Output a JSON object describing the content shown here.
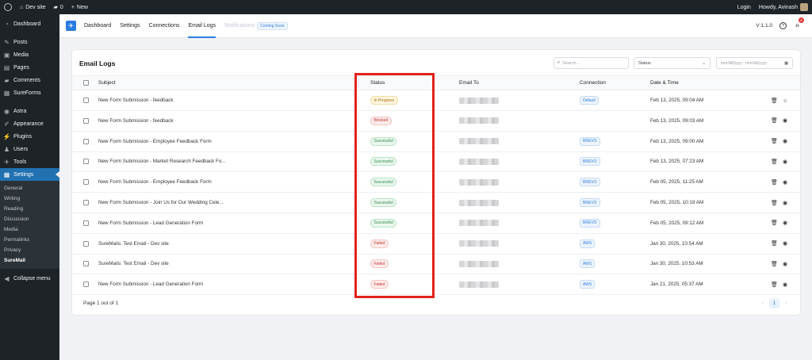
{
  "admin_bar": {
    "site_name": "Dev site",
    "comments_count": "0",
    "new_label": "New",
    "login_label": "Login",
    "howdy": "Howdy, Avinash"
  },
  "sidebar": {
    "items": [
      {
        "label": "Dashboard",
        "icon": "gauge-icon"
      },
      {
        "label": "Posts",
        "icon": "pin-icon"
      },
      {
        "label": "Media",
        "icon": "media-icon"
      },
      {
        "label": "Pages",
        "icon": "pages-icon"
      },
      {
        "label": "Comments",
        "icon": "comment-icon"
      },
      {
        "label": "SureForms",
        "icon": "sureforms-icon"
      },
      {
        "label": "Astra",
        "icon": "astra-icon"
      },
      {
        "label": "Appearance",
        "icon": "brush-icon"
      },
      {
        "label": "Plugins",
        "icon": "plug-icon"
      },
      {
        "label": "Users",
        "icon": "users-icon"
      },
      {
        "label": "Tools",
        "icon": "wrench-icon"
      },
      {
        "label": "Settings",
        "icon": "settings-icon"
      }
    ],
    "submenu": [
      "General",
      "Writing",
      "Reading",
      "Discussion",
      "Media",
      "Permalinks",
      "Privacy",
      "SureMail"
    ],
    "collapse_label": "Collapse menu"
  },
  "topnav": {
    "tabs": [
      "Dashboard",
      "Settings",
      "Connections",
      "Email Logs",
      "Notifications"
    ],
    "active_tab": "Email Logs",
    "coming_soon": "Coming Soon",
    "version": "V 1.1.0",
    "notification_count": "2"
  },
  "logs": {
    "title": "Email Logs",
    "search_placeholder": "Search...",
    "status_filter": "Status",
    "date_placeholder": "mm/dd/yyyy - mm/dd/yyyy",
    "columns": {
      "subject": "Subject",
      "status": "Status",
      "email_to": "Email To",
      "connection": "Connection",
      "datetime": "Date & Time"
    },
    "rows": [
      {
        "subject": "New Form Submission - feedback",
        "status": "In Progress",
        "status_type": "inprogress",
        "connection": "Default",
        "date": "Feb 13, 2025, 09:04 AM"
      },
      {
        "subject": "New Form Submission - feedback",
        "status": "Blocked",
        "status_type": "blocked",
        "connection": "",
        "date": "Feb 13, 2025, 09:03 AM"
      },
      {
        "subject": "New Form Submission - Employee Feedback Form",
        "status": "Successful",
        "status_type": "successful",
        "connection": "BREVO",
        "date": "Feb 13, 2025, 09:00 AM"
      },
      {
        "subject": "New Form Submission - Market Research Feedback Fo...",
        "status": "Successful",
        "status_type": "successful",
        "connection": "BREVO",
        "date": "Feb 13, 2025, 07:23 AM"
      },
      {
        "subject": "New Form Submission - Employee Feedback Form",
        "status": "Successful",
        "status_type": "successful",
        "connection": "BREVO",
        "date": "Feb 05, 2025, 11:25 AM"
      },
      {
        "subject": "New Form Submission - Join Us for Our Wedding Cele...",
        "status": "Successful",
        "status_type": "successful",
        "connection": "BREVO",
        "date": "Feb 05, 2025, 10:19 AM"
      },
      {
        "subject": "New Form Submission - Lead Generation Form",
        "status": "Successful",
        "status_type": "successful",
        "connection": "BREVO",
        "date": "Feb 05, 2025, 09:12 AM"
      },
      {
        "subject": "SureMails: Test Email - Dev site",
        "status": "Failed",
        "status_type": "failed",
        "connection": "AWS",
        "date": "Jan 30, 2025, 10:54 AM"
      },
      {
        "subject": "SureMails: Test Email - Dev site",
        "status": "Failed",
        "status_type": "failed",
        "connection": "AWS",
        "date": "Jan 30, 2025, 10:53 AM"
      },
      {
        "subject": "New Form Submission - Lead Generation Form",
        "status": "Failed",
        "status_type": "failed",
        "connection": "AWS",
        "date": "Jan 21, 2025, 05:37 AM"
      }
    ],
    "page_info": "Page 1 out of 1",
    "current_page": "1"
  },
  "colors": {
    "accent": "#2a7de1",
    "highlight_box": "#e2231a",
    "wp_admin_dark": "#1d2327",
    "wp_active_blue": "#2271b1"
  }
}
